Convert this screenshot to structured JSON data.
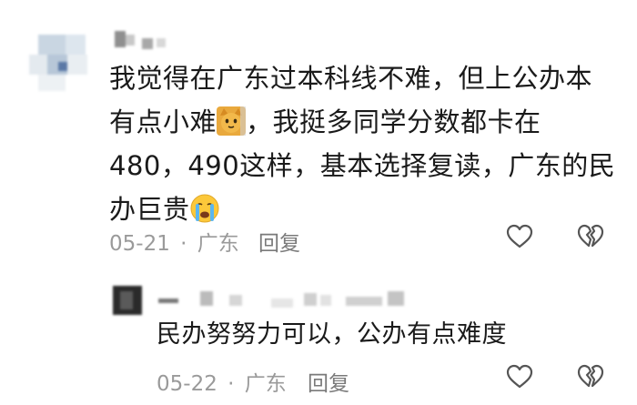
{
  "comment": {
    "text_line1": "我觉得在广东过本科线不难，但上公办本",
    "text_line2a": "有点小难",
    "text_line2b": "，我挺多同学分数都卡在",
    "text_line3": "480，490这样，基本选择复读，广东的民",
    "text_line4": "办巨贵",
    "emoji1": "cat-face-emoji",
    "emoji2": "crying-face-emoji",
    "date": "05-21",
    "separator": "·",
    "location": "广东",
    "reply_label": "回复"
  },
  "reply": {
    "text": "民办努努力可以，公办有点难度",
    "date": "05-22",
    "separator": "·",
    "location": "广东",
    "reply_label": "回复"
  },
  "icons": {
    "like": "heart-outline-icon",
    "dislike": "broken-heart-icon"
  }
}
